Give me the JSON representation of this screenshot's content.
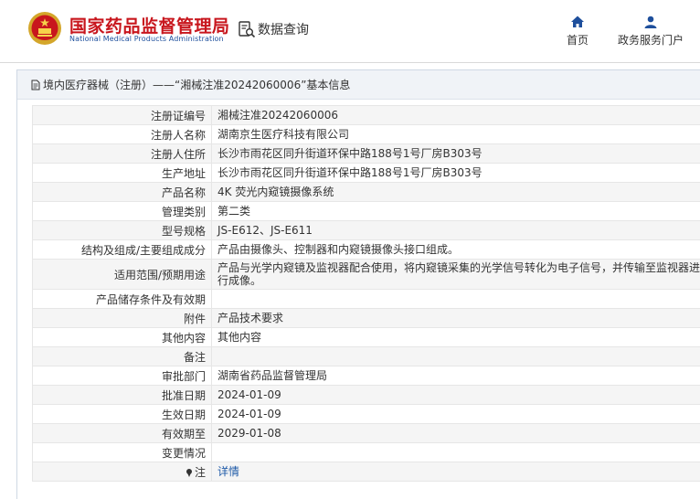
{
  "header": {
    "brand_cn": "国家药品监督管理局",
    "brand_en": "National Medical Products Administration",
    "query_label": "数据查询",
    "nav_home": "首页",
    "nav_gov": "政务服务门户"
  },
  "breadcrumb": "境内医疗器械（注册）——“湘械注准20242060006”基本信息",
  "rows": [
    {
      "label": "注册证编号",
      "value": "湘械注准20242060006"
    },
    {
      "label": "注册人名称",
      "value": "湖南京生医疗科技有限公司"
    },
    {
      "label": "注册人住所",
      "value": "长沙市雨花区同升街道环保中路188号1号厂房B303号"
    },
    {
      "label": "生产地址",
      "value": "长沙市雨花区同升街道环保中路188号1号厂房B303号"
    },
    {
      "label": "产品名称",
      "value": "4K 荧光内窥镜摄像系统"
    },
    {
      "label": "管理类别",
      "value": "第二类"
    },
    {
      "label": "型号规格",
      "value": "JS-E612、JS-E611"
    },
    {
      "label": "结构及组成/主要组成成分",
      "value": "产品由摄像头、控制器和内窥镜摄像头接口组成。"
    },
    {
      "label": "适用范围/预期用途",
      "value": "产品与光学内窥镜及监视器配合使用，将内窥镜采集的光学信号转化为电子信号，并传输至监视器进行成像。"
    },
    {
      "label": "产品储存条件及有效期",
      "value": ""
    },
    {
      "label": "附件",
      "value": "产品技术要求"
    },
    {
      "label": "其他内容",
      "value": "其他内容"
    },
    {
      "label": "备注",
      "value": ""
    },
    {
      "label": "审批部门",
      "value": "湖南省药品监督管理局"
    },
    {
      "label": "批准日期",
      "value": "2024-01-09"
    },
    {
      "label": "生效日期",
      "value": "2024-01-09"
    },
    {
      "label": "有效期至",
      "value": "2029-01-08"
    },
    {
      "label": "变更情况",
      "value": ""
    },
    {
      "label": "注",
      "value": "详情"
    }
  ],
  "colors": {
    "brand_red": "#c8161d",
    "brand_blue": "#1e4f9c",
    "link_blue": "#1e5aa8"
  }
}
